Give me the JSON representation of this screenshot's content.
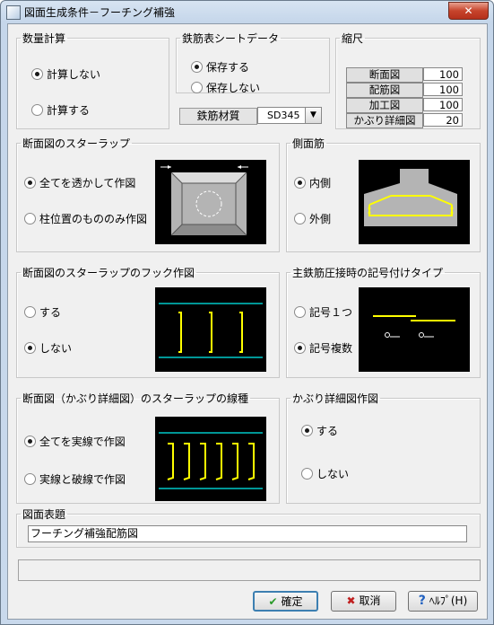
{
  "window": {
    "title": "図面生成条件－フーチング補強",
    "close": "✕"
  },
  "quantity": {
    "legend": "数量計算",
    "options": [
      "計算しない",
      "計算する"
    ],
    "selected": 0
  },
  "rebar_sheet": {
    "legend": "鉄筋表シートデータ",
    "options": [
      "保存する",
      "保存しない"
    ],
    "selected": 0
  },
  "material": {
    "label": "鉄筋材質",
    "value": "SD345"
  },
  "scale": {
    "legend": "縮尺",
    "rows": [
      {
        "label": "断面図",
        "value": "100"
      },
      {
        "label": "配筋図",
        "value": "100"
      },
      {
        "label": "加工図",
        "value": "100"
      },
      {
        "label": "かぶり詳細図",
        "value": "20"
      }
    ]
  },
  "section_stirrup": {
    "legend": "断面図のスターラップ",
    "options": [
      "全てを透かして作図",
      "柱位置のもののみ作図"
    ],
    "selected": 0
  },
  "side_rebar": {
    "legend": "側面筋",
    "options": [
      "内側",
      "外側"
    ],
    "selected": 0
  },
  "stirrup_hook": {
    "legend": "断面図のスターラップのフック作図",
    "options": [
      "する",
      "しない"
    ],
    "selected": 1
  },
  "joint_mark": {
    "legend": "主鉄筋圧接時の記号付けタイプ",
    "options": [
      "記号１つ",
      "記号複数"
    ],
    "selected": 1
  },
  "line_type": {
    "legend": "断面図（かぶり詳細図）のスターラップの線種",
    "options": [
      "全てを実線で作図",
      "実線と破線で作図"
    ],
    "selected": 0
  },
  "cover_detail": {
    "legend": "かぶり詳細図作図",
    "options": [
      "する",
      "しない"
    ],
    "selected": 0
  },
  "drawing_title": {
    "legend": "図面表題",
    "value": "フーチング補強配筋図"
  },
  "buttons": {
    "ok": "確定",
    "cancel": "取消",
    "help": "ﾍﾙﾌﾟ(H)"
  },
  "colors": {
    "accent_yellow": "#ffff00",
    "accent_cyan": "#00c8c8",
    "preview_bg": "#000000"
  }
}
